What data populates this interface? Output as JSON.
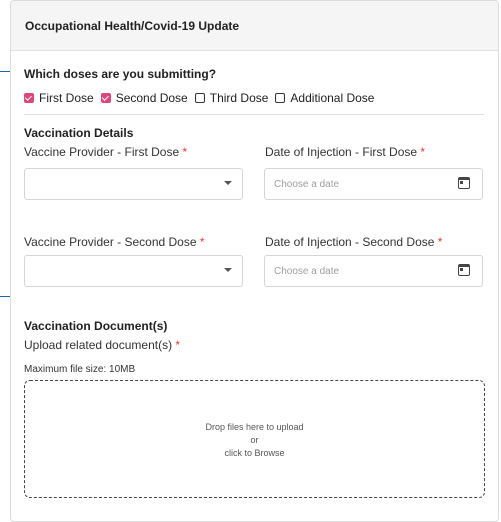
{
  "header": {
    "title": "Occupational Health/Covid-19 Update"
  },
  "doses": {
    "question": "Which doses are you submitting?",
    "options": [
      {
        "label": "First Dose",
        "checked": true
      },
      {
        "label": "Second Dose",
        "checked": true
      },
      {
        "label": "Third Dose",
        "checked": false
      },
      {
        "label": "Additional Dose",
        "checked": false
      }
    ]
  },
  "vaccination": {
    "section_title": "Vaccination Details",
    "provider_first_label": "Vaccine Provider - First Dose",
    "date_first_label": "Date of Injection - First Dose",
    "provider_second_label": "Vaccine Provider - Second Dose",
    "date_second_label": "Date of Injection - Second Dose",
    "required_mark": "*",
    "date_placeholder": "Choose a date"
  },
  "documents": {
    "section_title": "Vaccination Document(s)",
    "upload_label": "Upload related document(s)",
    "max_size": "Maximum file size: 10MB",
    "drop_line1": "Drop files here to upload",
    "drop_line2": "or",
    "drop_line3": "click to Browse"
  },
  "colors": {
    "accent": "#1e5fa8",
    "checkbox": "#e0457b",
    "required": "#e53935"
  }
}
